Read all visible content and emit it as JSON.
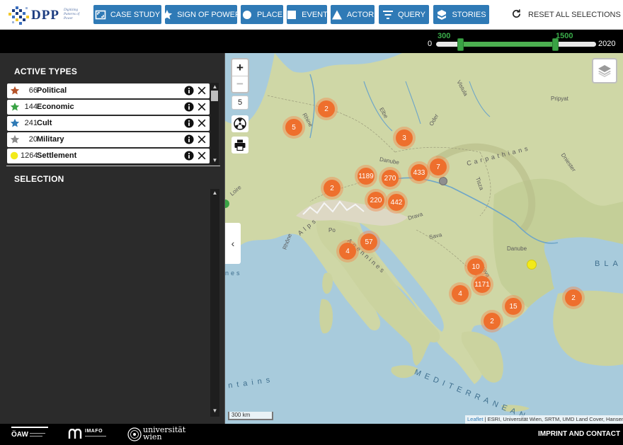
{
  "app": {
    "logo_text": "DPP",
    "logo_tagline": "Digitizing Patterns of Power"
  },
  "nav": {
    "buttons": [
      {
        "label": "CASE STUDY",
        "icon": "fullscreen-frame-icon"
      },
      {
        "label": "SIGN OF POWER",
        "icon": "star-icon"
      },
      {
        "label": "PLACE",
        "icon": "circle-icon"
      },
      {
        "label": "EVENT",
        "icon": "square-icon"
      },
      {
        "label": "ACTOR",
        "icon": "triangle-icon"
      },
      {
        "label": "QUERY",
        "icon": "filter-icon"
      },
      {
        "label": "STORIES",
        "icon": "stories-icon"
      }
    ],
    "reset_label": "RESET ALL SELECTIONS"
  },
  "timeline": {
    "min_label": "0",
    "max_label": "2020",
    "start_label": "300",
    "end_label": "1500",
    "min": 0,
    "max": 2020,
    "start": 300,
    "end": 1500
  },
  "sidebar": {
    "active_types_title": "ACTIVE TYPES",
    "selection_title": "SELECTION",
    "types": [
      {
        "count": "66",
        "name": "Political",
        "symbol": "star",
        "color": "#b5532a"
      },
      {
        "count": "144",
        "name": "Economic",
        "symbol": "star",
        "color": "#3aa345"
      },
      {
        "count": "241",
        "name": "Cult",
        "symbol": "star",
        "color": "#2f7ab6"
      },
      {
        "count": "20",
        "name": "Military",
        "symbol": "star",
        "color": "#8a8a8a"
      },
      {
        "count": "1264",
        "name": "Settlement",
        "symbol": "circle",
        "color": "#f2ea1a"
      }
    ]
  },
  "map": {
    "zoom_in": "+",
    "zoom_out": "−",
    "zoom_level": "5",
    "scale_label": "300 km",
    "attribution_link": "Leaflet",
    "attribution_text": " | ESRI, Universität Wien, SRTM, UMD Land Cover, Hansen",
    "clusters": [
      "2",
      "5",
      "3",
      "1189",
      "270",
      "433",
      "7",
      "2",
      "220",
      "442",
      "57",
      "4",
      "10",
      "1171",
      "4",
      "15",
      "2",
      "2"
    ],
    "labels": [
      "Vistula",
      "Pripyat",
      "Elbe",
      "Oder",
      "Rhine",
      "Danube",
      "Carpathians",
      "Dniester",
      "Tisza",
      "Danube",
      "Loire",
      "Apennines",
      "Morava",
      "Drava",
      "Sava",
      "Po",
      "Rhône",
      "Alps"
    ],
    "seas": [
      "BLA",
      "MEDITERRANEAN",
      "ntains",
      "nes"
    ],
    "accent_color": "#ee6f2d"
  },
  "footer": {
    "logo_1": "ÖAW",
    "logo_2": "IMAFO",
    "logo_3": "universität wien",
    "imprint_label": "IMPRINT AND CONTACT"
  }
}
